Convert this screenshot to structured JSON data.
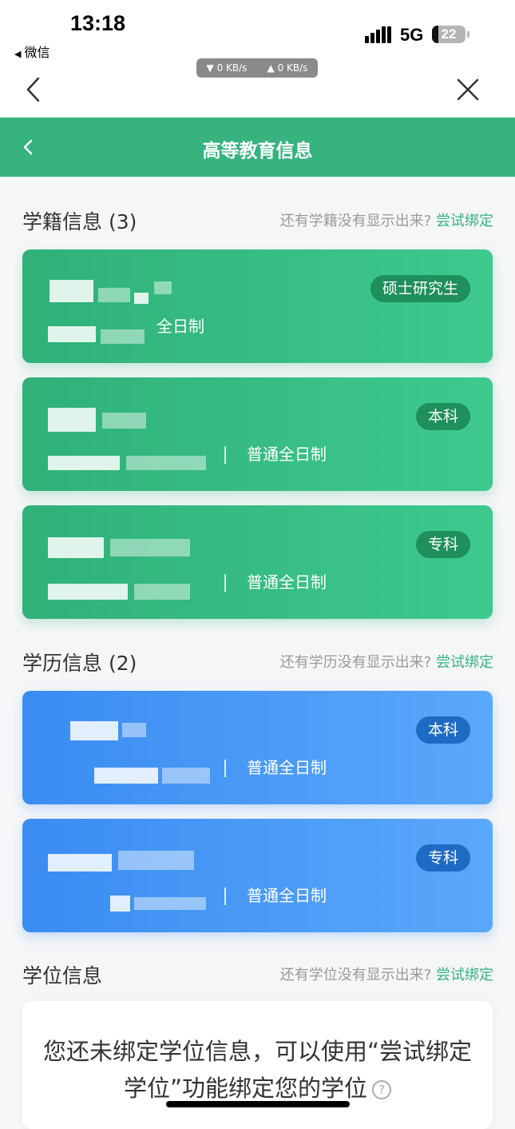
{
  "status_bar": {
    "time": "13:18",
    "back_app": "微信",
    "network": "5G",
    "battery": "22",
    "download_speed": "▼ 0 KB/s",
    "upload_speed": "▲ 0 KB/s"
  },
  "header": {
    "title": "高等教育信息"
  },
  "enrollment": {
    "title": "学籍信息 (3)",
    "hint": "还有学籍没有显示出来?",
    "link": "尝试绑定",
    "cards": [
      {
        "level": "硕士研究生",
        "mode": "全日制"
      },
      {
        "level": "本科",
        "mode": "普通全日制"
      },
      {
        "level": "专科",
        "mode": "普通全日制"
      }
    ]
  },
  "education": {
    "title": "学历信息 (2)",
    "hint": "还有学历没有显示出来?",
    "link": "尝试绑定",
    "cards": [
      {
        "level": "本科",
        "mode": "普通全日制"
      },
      {
        "level": "专科",
        "mode": "普通全日制"
      }
    ]
  },
  "degree": {
    "title": "学位信息",
    "hint": "还有学位没有显示出来?",
    "link": "尝试绑定",
    "empty_message": "您还未绑定学位信息，可以使用“尝试绑定学位”功能绑定您的学位",
    "help_icon": "?"
  },
  "colors": {
    "green": "#36b37e",
    "blue": "#3a8cf2"
  }
}
